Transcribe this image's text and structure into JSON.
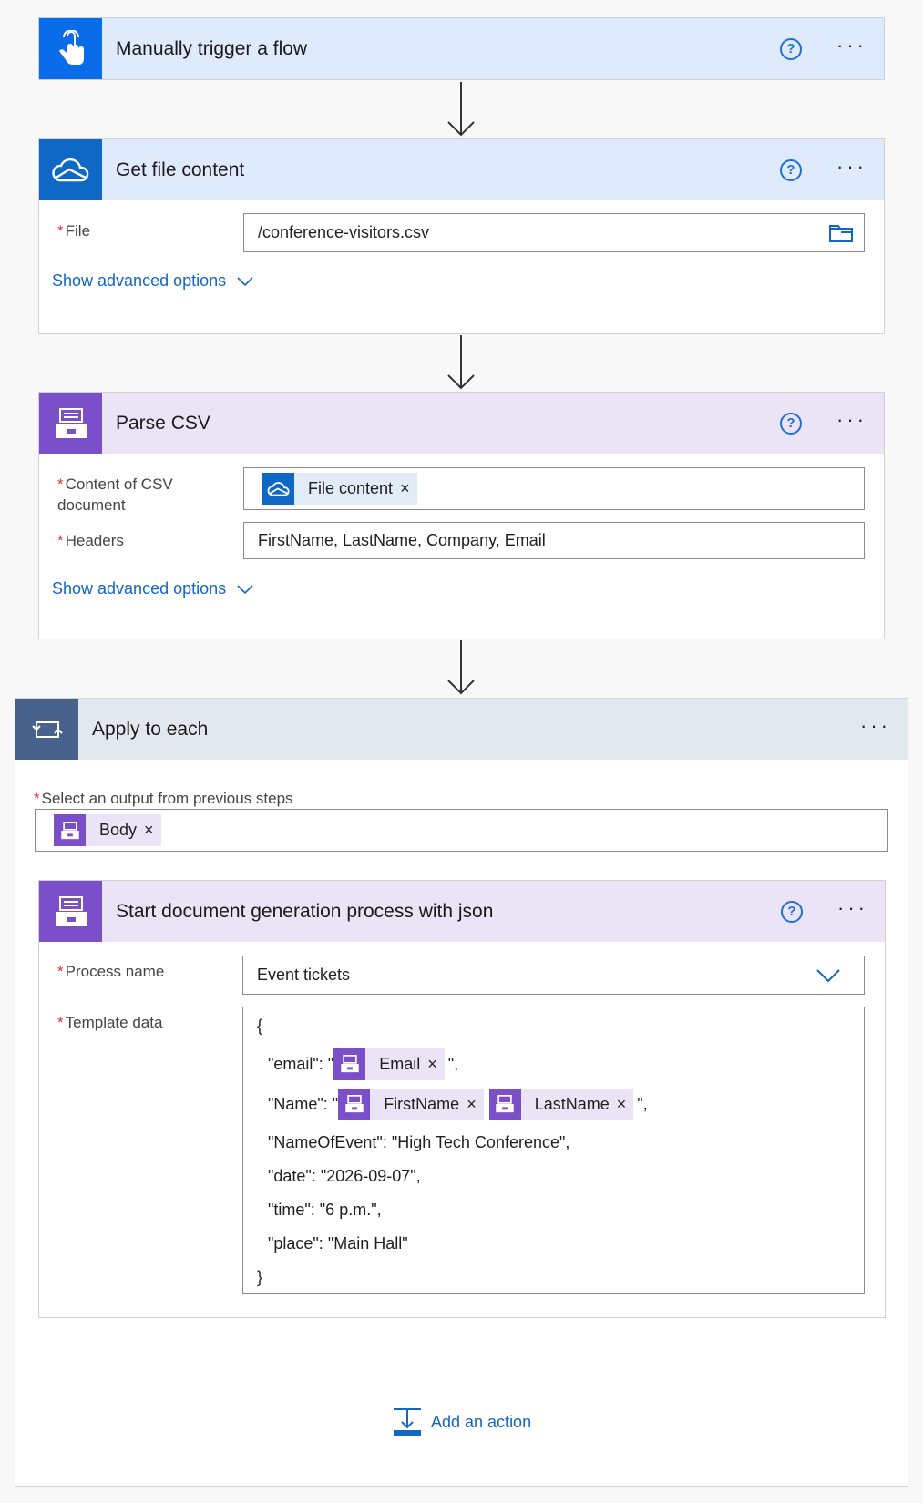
{
  "trigger": {
    "title": "Manually trigger a flow",
    "help": "?",
    "more": "···"
  },
  "get_file": {
    "title": "Get file content",
    "help": "?",
    "more": "···",
    "file_label": "File",
    "file_value": "/conference-visitors.csv",
    "advanced": "Show advanced options"
  },
  "parse_csv": {
    "title": "Parse CSV",
    "help": "?",
    "more": "···",
    "content_label": "Content of CSV document",
    "content_token": "File content",
    "headers_label": "Headers",
    "headers_value": "FirstName, LastName, Company, Email",
    "advanced": "Show advanced options"
  },
  "apply_each": {
    "title": "Apply to each",
    "more": "···",
    "select_label": "Select an output from previous steps",
    "body_token": "Body"
  },
  "docgen": {
    "title": "Start document generation process with json",
    "help": "?",
    "more": "···",
    "process_label": "Process name",
    "process_value": "Event tickets",
    "template_label": "Template data",
    "json": {
      "open": "{",
      "email_prefix": "\"email\": \"",
      "email_token": "Email",
      "email_suffix": "\",",
      "name_prefix": "\"Name\": \"",
      "first_token": "FirstName",
      "last_token": "LastName",
      "name_suffix": "\",",
      "event_line": "\"NameOfEvent\": \"High Tech Conference\",",
      "date_line": "\"date\": \"2026-09-07\",",
      "time_line": "\"time\": \"6 p.m.\",",
      "place_line": "\"place\": \"Main Hall\"",
      "close": "}"
    }
  },
  "add_action": "Add an action",
  "token_x": "×",
  "colors": {
    "trigger": "#0a6ce8",
    "onedrive": "#0f68c5",
    "encodian": "#7b4fc9",
    "loop": "#48638b",
    "accent": "#1466c4"
  }
}
